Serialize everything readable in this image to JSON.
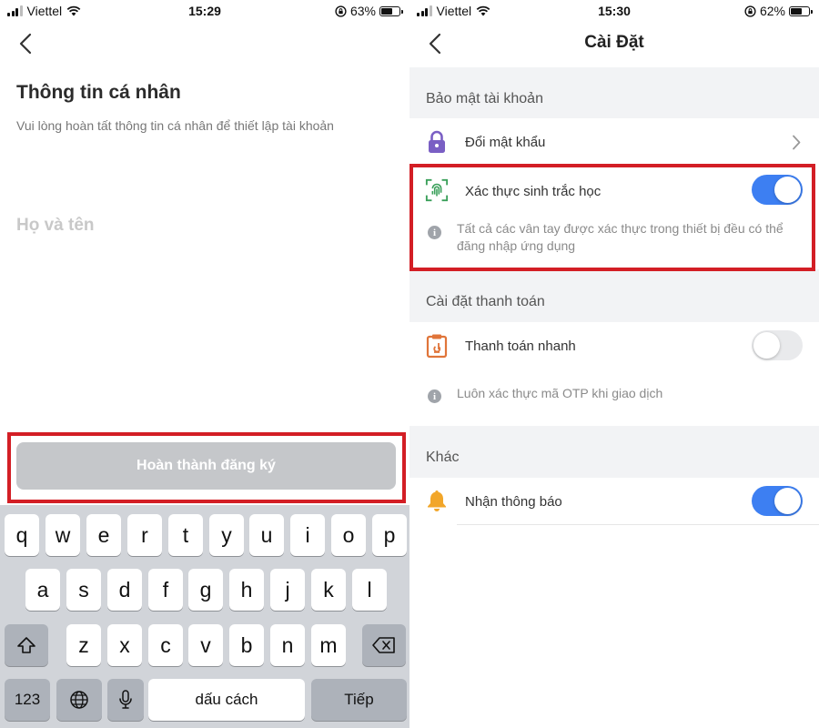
{
  "left_screen": {
    "status_bar": {
      "carrier": "Viettel",
      "time": "15:29",
      "battery": "63%",
      "battery_level": 0.63
    },
    "title": "Thông tin cá nhân",
    "subtitle": "Vui lòng hoàn tất thông tin cá nhân để thiết lập tài khoản",
    "name_input": {
      "placeholder": "Họ và tên",
      "value": ""
    },
    "submit_label": "Hoàn thành đăng ký",
    "keyboard": {
      "row1": [
        "q",
        "w",
        "e",
        "r",
        "t",
        "y",
        "u",
        "i",
        "o",
        "p"
      ],
      "row2": [
        "a",
        "s",
        "d",
        "f",
        "g",
        "h",
        "j",
        "k",
        "l"
      ],
      "row3": [
        "z",
        "x",
        "c",
        "v",
        "b",
        "n",
        "m"
      ],
      "numbers_key": "123",
      "space_label": "dấu cách",
      "return_label": "Tiếp"
    }
  },
  "right_screen": {
    "status_bar": {
      "carrier": "Viettel",
      "time": "15:30",
      "battery": "62%",
      "battery_level": 0.62
    },
    "title": "Cài Đặt",
    "sections": {
      "security": {
        "header": "Bảo mật tài khoản",
        "change_password": {
          "label": "Đổi mật khẩu",
          "icon": "lock-icon"
        },
        "biometric": {
          "label": "Xác thực sinh trắc học",
          "icon": "fingerprint-icon",
          "enabled": true,
          "info": "Tất cả các vân tay được xác thực trong thiết bị đều có thể đăng nhập ứng dụng"
        }
      },
      "payment": {
        "header": "Cài đặt thanh toán",
        "quick_pay": {
          "label": "Thanh toán nhanh",
          "icon": "quick-pay-icon",
          "enabled": false,
          "info": "Luôn xác thực mã OTP khi giao dịch"
        }
      },
      "other": {
        "header": "Khác",
        "notifications": {
          "label": "Nhận thông báo",
          "icon": "bell-icon",
          "enabled": true
        }
      }
    }
  },
  "colors": {
    "accent": "#3d7ff2",
    "highlight": "#d31e25",
    "button_disabled": "#c5c7ca",
    "keyboard_bg": "#d1d4d9"
  }
}
